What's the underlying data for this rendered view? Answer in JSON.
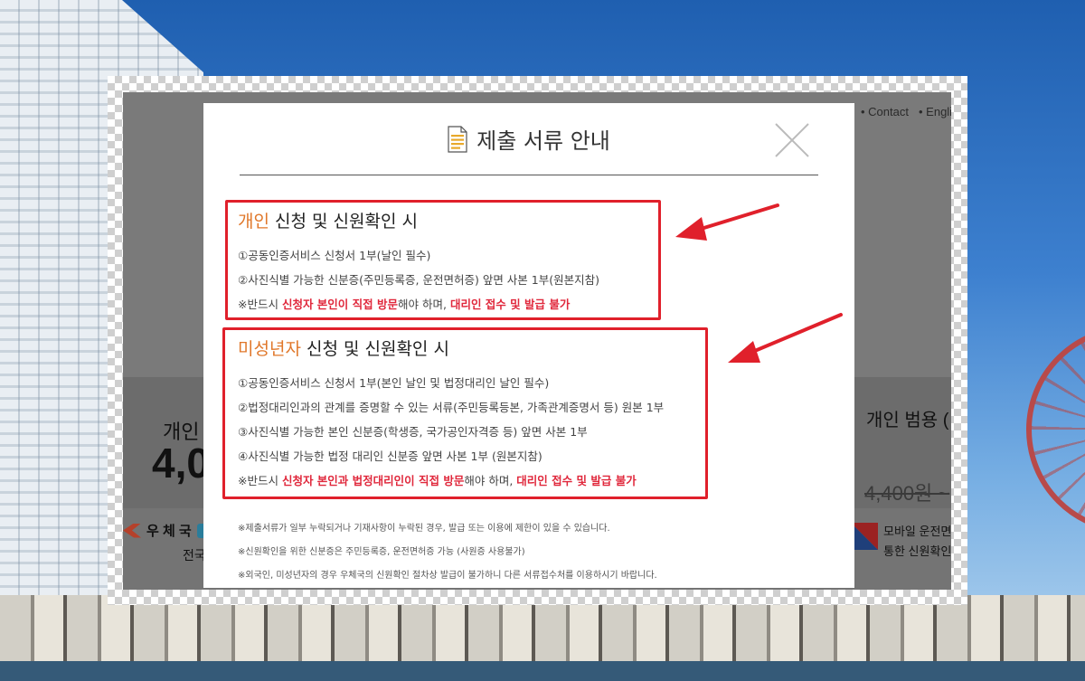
{
  "background": {
    "nav": {
      "contact": "• Contact",
      "english": "• Englis"
    },
    "left_card": {
      "title": "개인",
      "price": "4,0",
      "provider": "우 체 국",
      "desc": "전국"
    },
    "right_card": {
      "title": "개인 범용 (",
      "price": "4,400원 ~",
      "desc_line1": "모바일 운전면",
      "desc_line2": "통한 신원확인"
    }
  },
  "modal": {
    "title": "제출 서류 안내",
    "sections": [
      {
        "title_accent": "개인",
        "title_rest": " 신청 및 신원확인 시",
        "items": [
          "①공동인증서비스 신청서 1부(날인 필수)",
          "②사진식별 가능한 신분증(주민등록증, 운전면허증) 앞면 사본 1부(원본지참)"
        ],
        "note": {
          "prefix": "※반드시 ",
          "hl1": "신청자 본인이 직접 방문",
          "middle": "해야 하며, ",
          "hl2": "대리인 접수 및 발급 불가"
        }
      },
      {
        "title_accent": "미성년자",
        "title_rest": " 신청 및 신원확인 시",
        "items": [
          "①공동인증서비스 신청서 1부(본인 날인 및 법정대리인 날인 필수)",
          "②법정대리인과의 관계를 증명할 수 있는 서류(주민등록등본, 가족관계증명서 등) 원본 1부",
          "③사진식별 가능한 본인 신분증(학생증, 국가공인자격증 등) 앞면 사본 1부",
          "④사진식별 가능한 법정 대리인 신분증 앞면 사본 1부 (원본지참)"
        ],
        "note": {
          "prefix": "※반드시 ",
          "hl1": "신청자 본인과 법정대리인이 직접 방문",
          "middle": "해야 하며, ",
          "hl2": "대리인 접수 및 발급 불가"
        }
      }
    ],
    "footnotes": [
      "※제출서류가 일부 누락되거나 기재사항이 누락된 경우, 발급 또는 이용에 제한이 있을 수 있습니다.",
      "※신원확인을 위한 신분증은 주민등록증, 운전면허증 가능 (사원증 사용불가)",
      "※외국인, 미성년자의 경우 우체국의 신원확인 절차상 발급이 불가하니 다른 서류접수처를 이용하시기 바랍니다."
    ]
  },
  "colors": {
    "accent": "#e0772a",
    "highlight": "#e0283c",
    "annotation": "#e0202b"
  },
  "icons": {
    "doc": "document-icon",
    "close": "close-icon"
  }
}
